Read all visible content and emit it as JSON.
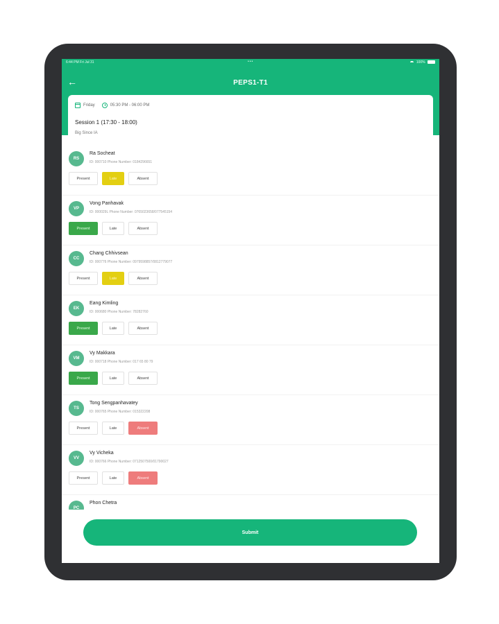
{
  "statusbar": {
    "time": "6:44 PM   Fri Jul 31",
    "dots": "•••",
    "battery": "100%"
  },
  "header": {
    "title": "PEPS1-T1"
  },
  "session": {
    "day": "Friday",
    "time": "05:30 PM - 06:00 PM",
    "title": "Session 1 (17:30 - 18:00)",
    "subtitle": "Big Since IA"
  },
  "labels": {
    "present": "Present",
    "late": "Late",
    "absent": "Absent"
  },
  "students": [
    {
      "initials": "RS",
      "name": "Ra  Socheat",
      "info": "ID: 000710    Phone Number: 0184296651",
      "status": "late"
    },
    {
      "initials": "VP",
      "name": "Vong Panhavak",
      "info": "ID: 000029L    Phone Number: 0765023658/077545154",
      "status": "present"
    },
    {
      "initials": "CC",
      "name": "Chang Chhivsean",
      "info": "ID: 000776    Phone Number: 0979598857/0812779077",
      "status": "late"
    },
    {
      "initials": "EK",
      "name": "Eang Kimling",
      "info": "ID: 000680    Phone Number: 78282760",
      "status": "present"
    },
    {
      "initials": "VM",
      "name": "Vy Makkara",
      "info": "ID: 000718    Phone Number: 017 65 80 79",
      "status": "present"
    },
    {
      "initials": "TS",
      "name": "Tong Sengpanhavatey",
      "info": "ID: 000765    Phone Number: 015322208",
      "status": "absent"
    },
    {
      "initials": "VV",
      "name": "Vy Vicheka",
      "info": "ID: 000766    Phone Number: 0712507500/01790027",
      "status": "absent"
    }
  ],
  "partial_student": {
    "initials": "PC",
    "name": "Phon Chetra"
  },
  "submit_label": "Submit"
}
